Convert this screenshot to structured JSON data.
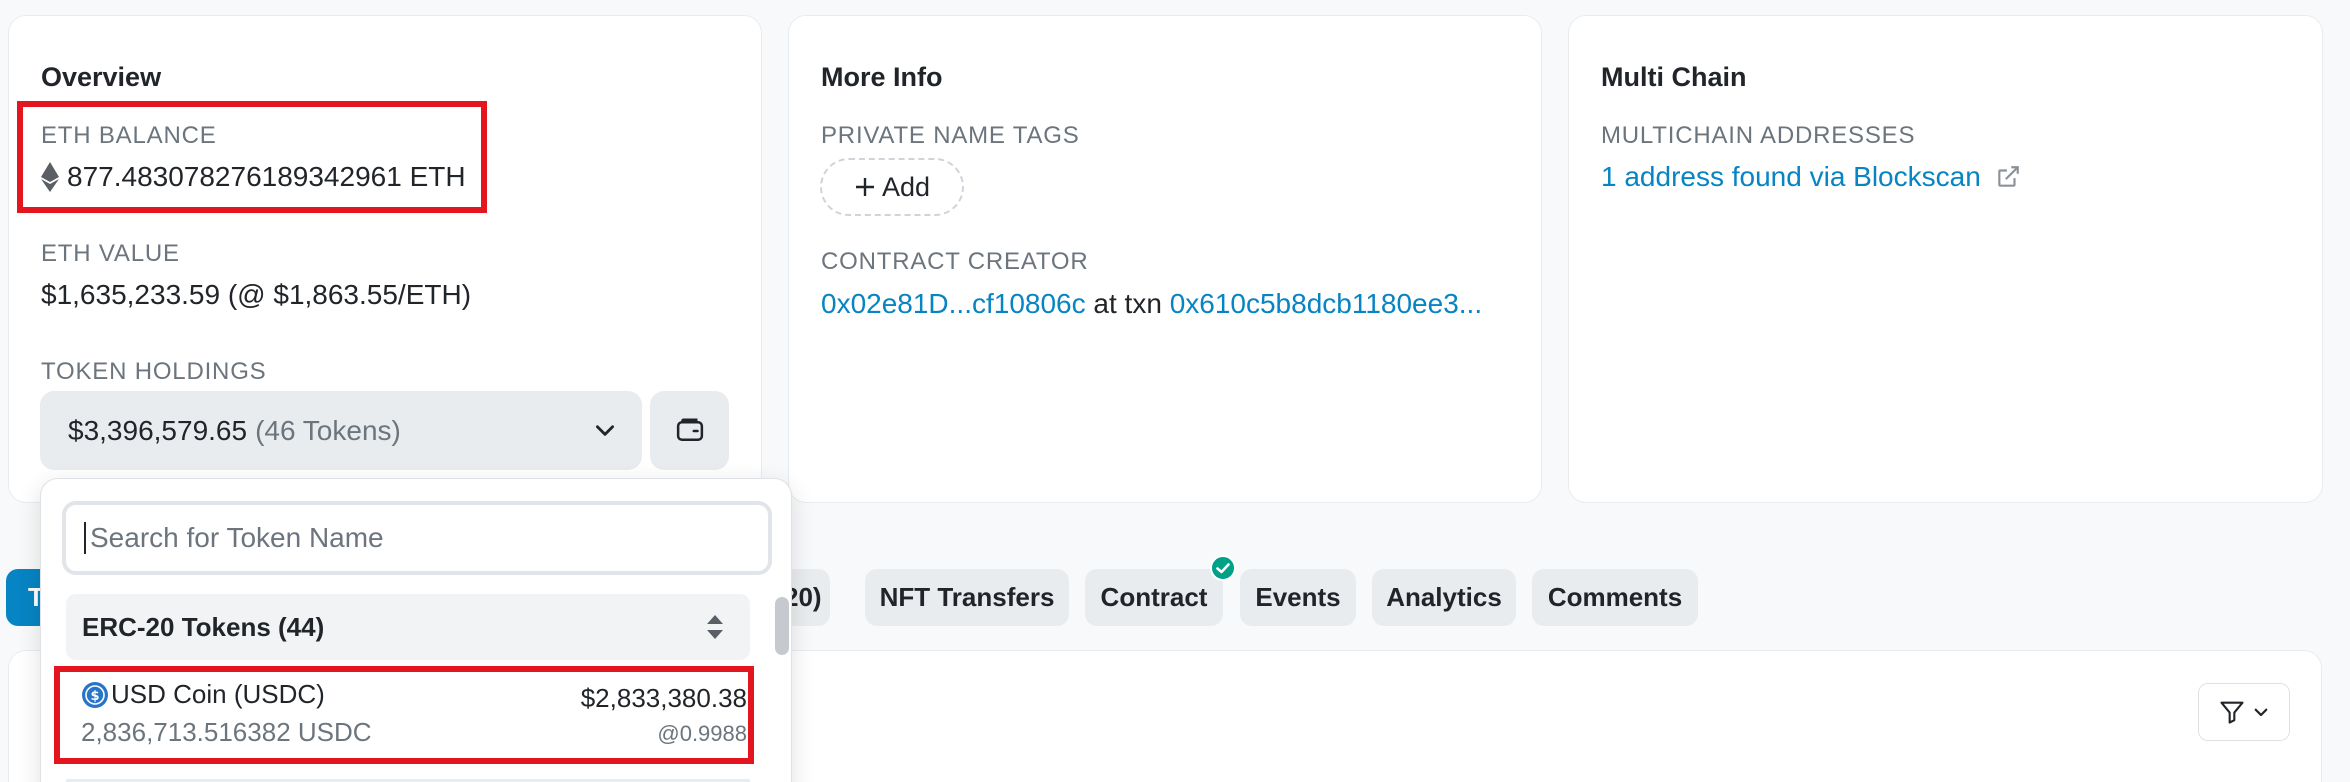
{
  "overview": {
    "title": "Overview",
    "eth_balance_label": "ETH BALANCE",
    "eth_balance_value": "877.483078276189342961 ETH",
    "eth_value_label": "ETH VALUE",
    "eth_value_value": "$1,635,233.59 (@ $1,863.55/ETH)",
    "token_holdings_label": "TOKEN HOLDINGS",
    "token_holdings_value": "$3,396,579.65",
    "token_holdings_count": "(46 Tokens)"
  },
  "more_info": {
    "title": "More Info",
    "private_tags_label": "PRIVATE NAME TAGS",
    "add_label": "Add",
    "contract_creator_label": "CONTRACT CREATOR",
    "creator_address": "0x02e81D...cf10806c",
    "at_txn": "at txn",
    "txn_hash": "0x610c5b8dcb1180ee3..."
  },
  "multi_chain": {
    "title": "Multi Chain",
    "addresses_label": "MULTICHAIN ADDRESSES",
    "addresses_link": "1 address found via Blockscan"
  },
  "tabs": [
    {
      "label": "T"
    },
    {
      "label": "20)"
    },
    {
      "label": "NFT Transfers"
    },
    {
      "label": "Contract"
    },
    {
      "label": "Events"
    },
    {
      "label": "Analytics"
    },
    {
      "label": "Comments"
    }
  ],
  "dropdown": {
    "search_placeholder": "Search for Token Name",
    "group_label": "ERC-20 Tokens (44)",
    "tokens": [
      {
        "name": "USD Coin (USDC)",
        "amount": "2,836,713.516382 USDC",
        "value": "$2,833,380.38",
        "rate": "@0.9988"
      }
    ]
  },
  "colors": {
    "accent": "#0784c3",
    "highlight": "#e3151f",
    "verified": "#00a186",
    "usdc": "#2775ca"
  }
}
